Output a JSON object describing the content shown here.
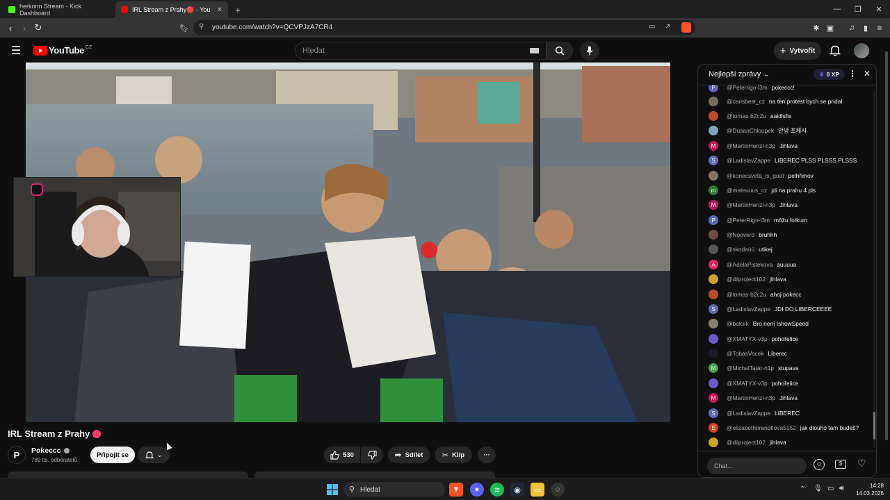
{
  "browser": {
    "tabs": [
      {
        "label": "herkonn Stream - Kick Dashboard",
        "active": false
      },
      {
        "label": "IRL Stream z Prahy🔴 - YouTube",
        "active": true
      }
    ],
    "url": "youtube.com/watch?v=QCVPJzA7CR4",
    "brave_badge": "0"
  },
  "youtube": {
    "logo_text": "YouTube",
    "region": "CZ",
    "search_placeholder": "Hledat",
    "create_label": "Vytvořit"
  },
  "video": {
    "title": "IRL Stream z Prahy",
    "title_badge": "🔴",
    "channel_name": "Pokeccc",
    "subscribers": "789 tis. odběratelů",
    "join_label": "Připojit se",
    "likes": "530",
    "share_label": "Sdílet",
    "clip_label": "Klip",
    "more_label": "···"
  },
  "chat": {
    "header_title": "Nejlepší zprávy",
    "xp_label": "0 XP",
    "input_placeholder": "Chat...",
    "messages": [
      {
        "author": "@Peterrigo-l3m",
        "text": "pokeccc!",
        "color": "#5b5fc7",
        "initial": "P"
      },
      {
        "author": "@carisbest_cz",
        "text": "na ten protest bych se pridal",
        "color": "#7a6a58",
        "initial": ""
      },
      {
        "author": "@tomas-b2c2u",
        "text": "aaldlsfis",
        "color": "#c04a2b",
        "initial": ""
      },
      {
        "author": "@DusanChloupek",
        "text": "안녕 포케시",
        "color": "#7aa6c2",
        "initial": ""
      },
      {
        "author": "@MartinHenzl-n3p",
        "text": "Jihlava",
        "color": "#c2185b",
        "initial": "M"
      },
      {
        "author": "@LadislavZappe",
        "text": "LIBEREC PLSS PLSSS PLSSS",
        "color": "#5c6bc0",
        "initial": "S"
      },
      {
        "author": "@konecsveta_is_goat",
        "text": "pelhřimov",
        "color": "#8d6e63",
        "initial": ""
      },
      {
        "author": "@mateuuus_cz",
        "text": "jdi na prahu 4 pls",
        "color": "#2e7d32",
        "initial": "m"
      },
      {
        "author": "@MartinHenzl-n3p",
        "text": "Jihlava",
        "color": "#c2185b",
        "initial": "M"
      },
      {
        "author": "@PeterRigo-l3m",
        "text": "môžu fotkum",
        "color": "#5c6bc0",
        "initial": "P"
      },
      {
        "author": "@Nooverd",
        "text": "bruhhh",
        "color": "#6d4c41",
        "initial": ""
      },
      {
        "author": "@skodaúú",
        "text": "utikej",
        "color": "#555555",
        "initial": ""
      },
      {
        "author": "@AdelaPistekova",
        "text": "auuuua",
        "color": "#e91e63",
        "initial": "A"
      },
      {
        "author": "@diiproject102",
        "text": "jihlava",
        "color": "#c9a227",
        "initial": ""
      },
      {
        "author": "@tomas-b2c2u",
        "text": "ahoj pokecc",
        "color": "#c04a2b",
        "initial": ""
      },
      {
        "author": "@LadislavZappe",
        "text": "JDI DO LIBERCEEEE",
        "color": "#5c6bc0",
        "initial": "S"
      },
      {
        "author": "@balciik",
        "text": "Bro není IshowSpeed",
        "color": "#8b7d6b",
        "initial": ""
      },
      {
        "author": "@XMATYX-v3p",
        "text": "pohořelice",
        "color": "#6a5acd",
        "initial": ""
      },
      {
        "author": "@TobasVacek",
        "text": "Liberec",
        "color": "#1a1a2e",
        "initial": ""
      },
      {
        "author": "@MichalTatár-n1p",
        "text": "stupava",
        "color": "#43a047",
        "initial": "M"
      },
      {
        "author": "@XMATYX-v3p",
        "text": "pohořelice",
        "color": "#6a5acd",
        "initial": ""
      },
      {
        "author": "@MartinHenzl-n3p",
        "text": "Jihlava",
        "color": "#c2185b",
        "initial": "M"
      },
      {
        "author": "@LadislavZappe",
        "text": "LIBEREC",
        "color": "#5c6bc0",
        "initial": "S"
      },
      {
        "author": "@elizabethbrandtlova5152",
        "text": "jak dlouho tam budeš?",
        "color": "#d84315",
        "initial": "E"
      },
      {
        "author": "@diiproject102",
        "text": "jihlava",
        "color": "#c9a227",
        "initial": ""
      }
    ]
  },
  "taskbar": {
    "search_placeholder": "Hledat",
    "time": "14:28",
    "date": "14.03.2026"
  }
}
